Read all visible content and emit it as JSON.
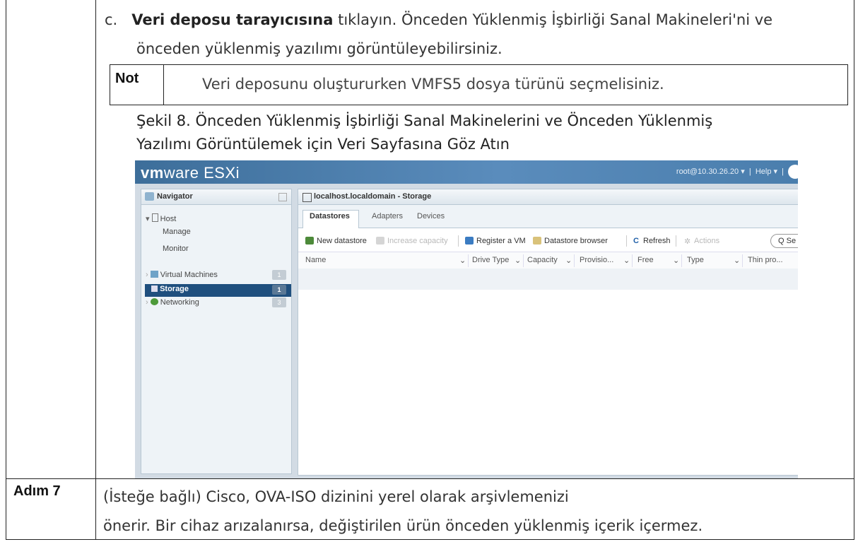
{
  "step_c": {
    "marker": "c.",
    "bold": "Veri deposu tarayıcısına",
    "rest": " tıklayın. Önceden Yüklenmiş İşbirliği Sanal Makineleri'ni ve",
    "line2": "önceden yüklenmiş yazılımı görüntüleyebilirsiniz."
  },
  "note": {
    "label": "Not",
    "text": "Veri deposunu oluştururken VMFS5 dosya türünü seçmelisiniz."
  },
  "figure": {
    "caption_line1": "Şekil 8. Önceden Yüklenmiş İşbirliği Sanal Makinelerini ve Önceden Yüklenmiş",
    "caption_line2": "Yazılımı Görüntülemek için Veri Sayfasına Göz Atın"
  },
  "esxi": {
    "logo_vm": "vm",
    "logo_ware": "ware",
    "logo_product": "ESXi",
    "user": "root@10.30.26.20 ▾",
    "help": "Help ▾",
    "navigator": {
      "title": "Navigator",
      "host": "Host",
      "manage": "Manage",
      "monitor": "Monitor",
      "vms": "Virtual Machines",
      "vms_count": "1",
      "storage": "Storage",
      "storage_count": "1",
      "networking": "Networking",
      "networking_count": "3"
    },
    "main_title": "localhost.localdomain - Storage",
    "tabs": [
      "Datastores",
      "Adapters",
      "Devices"
    ],
    "toolbar": {
      "new_datastore": "New datastore",
      "increase_capacity": "Increase capacity",
      "register_vm": "Register a VM",
      "datastore_browser": "Datastore browser",
      "refresh": "Refresh",
      "actions": "Actions",
      "search": "Q Se"
    },
    "columns": [
      "Name",
      "Drive Type",
      "Capacity",
      "Provisio...",
      "Free",
      "Type",
      "Thin pro..."
    ]
  },
  "step7": {
    "label": "Adım 7",
    "line1": "(İsteğe bağlı) Cisco, OVA-ISO dizinini yerel olarak arşivlemenizi",
    "line2": "önerir. Bir cihaz arızalanırsa, değiştirilen ürün önceden yüklenmiş içerik içermez."
  },
  "colors": {
    "esxi_topbar": "#4a7ead",
    "nav_selected": "#1f4f7e",
    "refresh_icon": "#1f5fa8"
  }
}
